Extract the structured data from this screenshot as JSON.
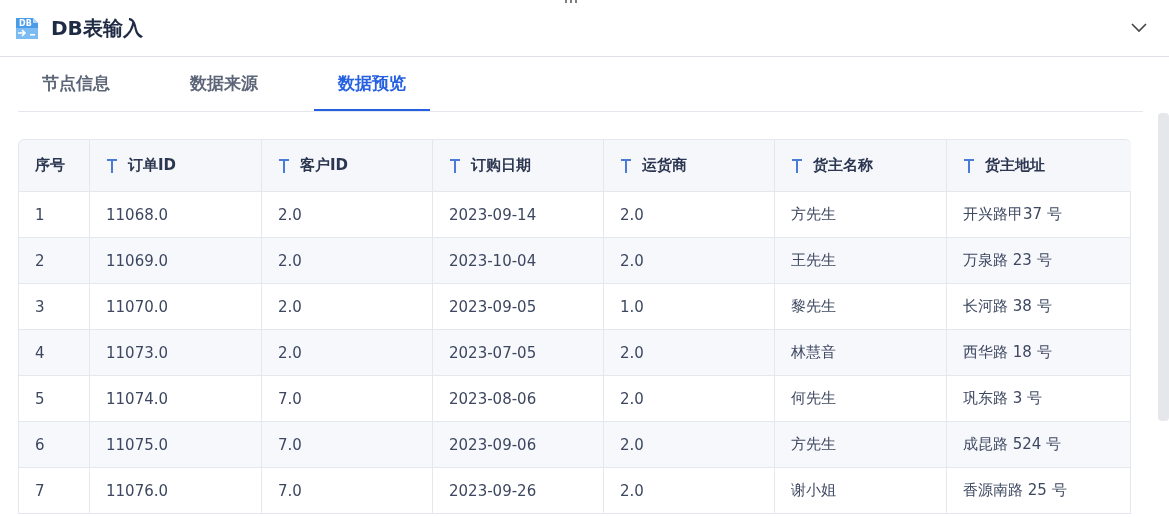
{
  "header": {
    "icon_label": "DB",
    "title": "DB表输入"
  },
  "tabs": [
    {
      "label": "节点信息",
      "selected": false
    },
    {
      "label": "数据来源",
      "selected": false
    },
    {
      "label": "数据预览",
      "selected": true
    }
  ],
  "table": {
    "columns": [
      {
        "label": "序号",
        "kind": "index"
      },
      {
        "label": "订单ID",
        "kind": "text"
      },
      {
        "label": "客户ID",
        "kind": "text"
      },
      {
        "label": "订购日期",
        "kind": "text"
      },
      {
        "label": "运货商",
        "kind": "text"
      },
      {
        "label": "货主名称",
        "kind": "text"
      },
      {
        "label": "货主地址",
        "kind": "text"
      }
    ],
    "rows": [
      [
        "1",
        "11068.0",
        "2.0",
        "2023-09-14",
        "2.0",
        "方先生",
        "开兴路甲37 号"
      ],
      [
        "2",
        "11069.0",
        "2.0",
        "2023-10-04",
        "2.0",
        "王先生",
        "万泉路 23 号"
      ],
      [
        "3",
        "11070.0",
        "2.0",
        "2023-09-05",
        "1.0",
        "黎先生",
        "长河路 38 号"
      ],
      [
        "4",
        "11073.0",
        "2.0",
        "2023-07-05",
        "2.0",
        "林慧音",
        "西华路 18 号"
      ],
      [
        "5",
        "11074.0",
        "7.0",
        "2023-08-06",
        "2.0",
        "何先生",
        "巩东路 3 号"
      ],
      [
        "6",
        "11075.0",
        "7.0",
        "2023-09-06",
        "2.0",
        "方先生",
        "成昆路 524 号"
      ],
      [
        "7",
        "11076.0",
        "7.0",
        "2023-09-26",
        "2.0",
        "谢小姐",
        "香源南路 25 号"
      ]
    ]
  }
}
